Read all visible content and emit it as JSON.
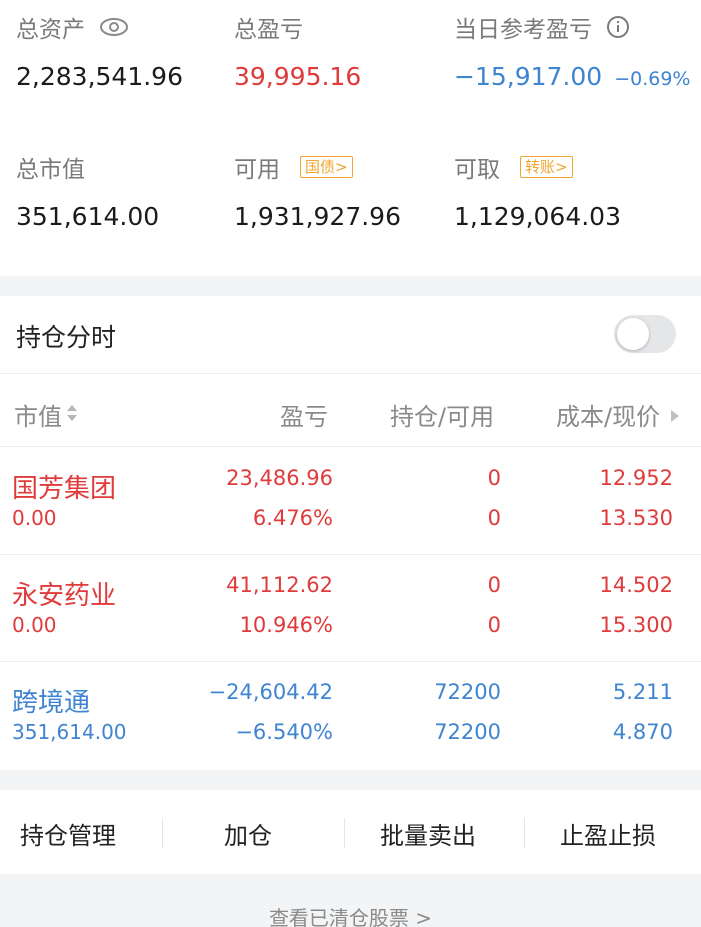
{
  "summary": {
    "total_assets": {
      "label": "总资产",
      "value": "2,283,541.96"
    },
    "total_pnl": {
      "label": "总盈亏",
      "value": "39,995.16"
    },
    "daily_pnl": {
      "label": "当日参考盈亏",
      "value": "−15,917.00",
      "pct": "−0.69%"
    },
    "market_value": {
      "label": "总市值",
      "value": "351,614.00"
    },
    "available": {
      "label": "可用",
      "tag": "国债>",
      "value": "1,931,927.96"
    },
    "withdrawable": {
      "label": "可取",
      "tag": "转账>",
      "value": "1,129,064.03"
    }
  },
  "timeshare": {
    "label": "持仓分时",
    "enabled": false
  },
  "table": {
    "headers": {
      "market_value": "市值",
      "pnl": "盈亏",
      "position": "持仓/可用",
      "cost_price": "成本/现价"
    },
    "rows": [
      {
        "name": "国芳集团",
        "market_value": "0.00",
        "pnl": "23,486.96",
        "pnl_pct": "6.476%",
        "position": "0",
        "available": "0",
        "cost": "12.952",
        "price": "13.530",
        "color": "#e03a3a"
      },
      {
        "name": "永安药业",
        "market_value": "0.00",
        "pnl": "41,112.62",
        "pnl_pct": "10.946%",
        "position": "0",
        "available": "0",
        "cost": "14.502",
        "price": "15.300",
        "color": "#e03a3a"
      },
      {
        "name": "跨境通",
        "market_value": "351,614.00",
        "pnl": "−24,604.42",
        "pnl_pct": "−6.540%",
        "position": "72200",
        "available": "72200",
        "cost": "5.211",
        "price": "4.870",
        "color": "#3f84d1"
      }
    ]
  },
  "actions": {
    "manage": "持仓管理",
    "add": "加仓",
    "batch_sell": "批量卖出",
    "stop": "止盈止损"
  },
  "footer": {
    "cleared_link": "查看已清仓股票 >"
  },
  "colors": {
    "up": "#e03a3a",
    "down": "#3f84d1",
    "tag": "#f0a530",
    "muted": "#7a7a7a"
  },
  "icons": {
    "eye": "eye-icon",
    "info": "info-icon",
    "sort": "sort-icon",
    "arrow": "right-arrow-icon"
  }
}
